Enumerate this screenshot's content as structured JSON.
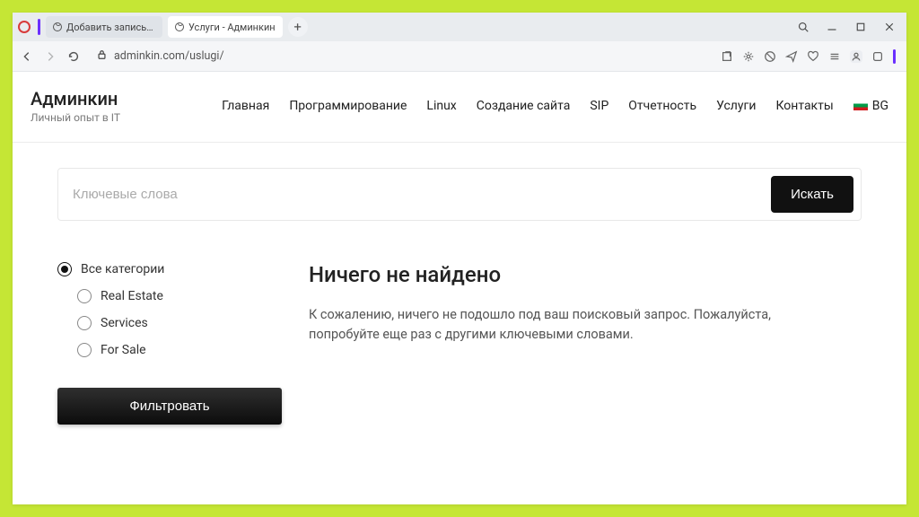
{
  "browser": {
    "tabs": [
      {
        "title": "Добавить запись ‹ Адми",
        "active": false
      },
      {
        "title": "Услуги - Админкин",
        "active": true
      }
    ],
    "url": "adminkin.com/uslugi/"
  },
  "site": {
    "brand_title": "Админкин",
    "brand_tagline": "Личный опыт в IT",
    "nav": {
      "home": "Главная",
      "programming": "Программирование",
      "linux": "Linux",
      "site_creation": "Создание сайта",
      "sip": "SIP",
      "reporting": "Отчетность",
      "services": "Услуги",
      "contacts": "Контакты",
      "lang": "BG"
    }
  },
  "search": {
    "placeholder": "Ключевые слова",
    "button": "Искать"
  },
  "categories": {
    "all": "Все категории",
    "real_estate": "Real Estate",
    "services": "Services",
    "for_sale": "For Sale",
    "filter_button": "Фильтровать"
  },
  "results": {
    "heading": "Ничего не найдено",
    "message": "К сожалению, ничего не подошло под ваш поисковый запрос. Пожалуйста, попробуйте еще раз с другими ключевыми словами."
  }
}
